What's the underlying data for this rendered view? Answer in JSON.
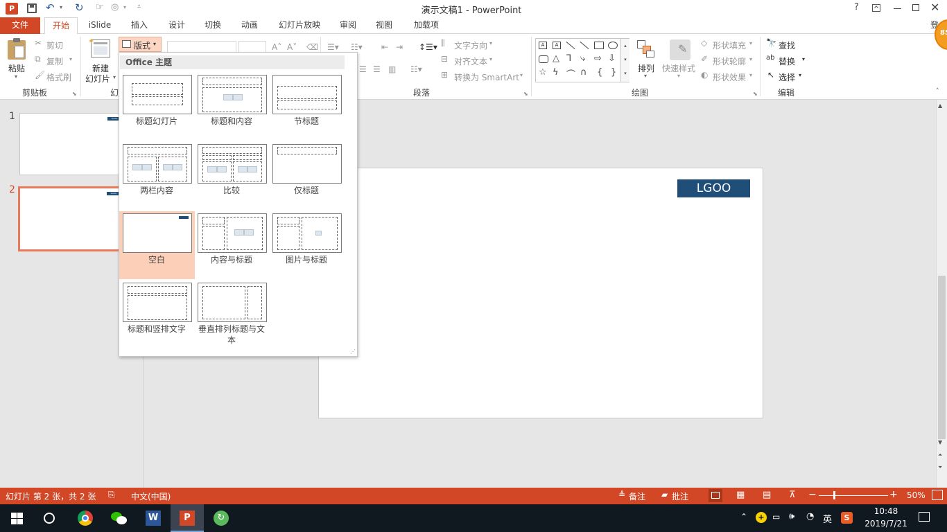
{
  "window": {
    "title": "演示文稿1 - PowerPoint",
    "help": "?",
    "login_partial": "登"
  },
  "tabs": [
    "文件",
    "开始",
    "iSlide",
    "插入",
    "设计",
    "切换",
    "动画",
    "幻灯片放映",
    "审阅",
    "视图",
    "加载项"
  ],
  "active_tab": "开始",
  "ribbon": {
    "clipboard": {
      "paste": "粘贴",
      "cut": "剪切",
      "copy": "复制",
      "format_painter": "格式刷",
      "group_label": "剪贴板"
    },
    "slides": {
      "new_slide_line1": "新建",
      "new_slide_line2": "幻灯片",
      "layout": "版式",
      "group_label_partial": "幻"
    },
    "paragraph": {
      "text_direction": "文字方向",
      "align_text": "对齐文本",
      "convert_smartart": "转换为 SmartArt",
      "group_label": "段落"
    },
    "drawing": {
      "arrange": "排列",
      "quick_styles": "快速样式",
      "shape_fill": "形状填充",
      "shape_outline": "形状轮廓",
      "shape_effects": "形状效果",
      "group_label": "绘图"
    },
    "editing": {
      "find": "查找",
      "replace": "替换",
      "select": "选择",
      "group_label": "编辑"
    }
  },
  "layout_dropdown": {
    "header": "Office 主题",
    "layouts": [
      {
        "label": "标题幻灯片"
      },
      {
        "label": "标题和内容"
      },
      {
        "label": "节标题"
      },
      {
        "label": "两栏内容"
      },
      {
        "label": "比较"
      },
      {
        "label": "仅标题"
      },
      {
        "label": "空白"
      },
      {
        "label": "内容与标题"
      },
      {
        "label": "图片与标题"
      },
      {
        "label": "标题和竖排文字"
      },
      {
        "label": "垂直排列标题与文本"
      }
    ],
    "selected": "空白"
  },
  "thumbnails": [
    {
      "number": "1",
      "logo": "LGOO"
    },
    {
      "number": "2",
      "logo": "LGOO"
    }
  ],
  "slide": {
    "logo_text": "LGOO",
    "logo_color": "#1f4e79"
  },
  "statusbar": {
    "slide_info": "幻灯片 第 2 张，共 2 张",
    "language": "中文(中国)",
    "notes": "备注",
    "comments": "批注",
    "zoom": "50%"
  },
  "taskbar": {
    "ime": "英",
    "time": "10:48",
    "date": "2019/7/21"
  },
  "notification_badge": "85",
  "colors": {
    "accent": "#d24726",
    "selected_layout_bg": "#fccfb8",
    "taskbar": "#101820"
  }
}
